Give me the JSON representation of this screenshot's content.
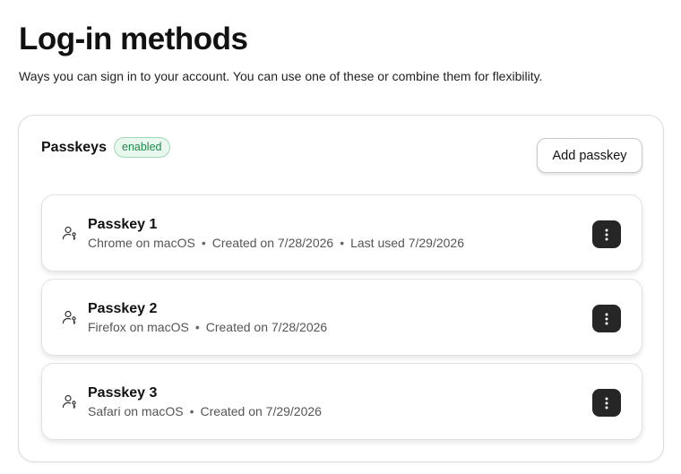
{
  "header": {
    "title": "Log-in methods",
    "subtitle": "Ways you can sign in to your account. You can use one of these or combine them for flexibility."
  },
  "passkeys_section": {
    "title": "Passkeys",
    "badge": "enabled",
    "add_button_label": "Add passkey",
    "separator": "•",
    "items": [
      {
        "name": "Passkey 1",
        "browser": "Chrome on macOS",
        "created": "Created on 7/28/2026",
        "last_used": "Last used 7/29/2026"
      },
      {
        "name": "Passkey 2",
        "browser": "Firefox on macOS",
        "created": "Created on 7/28/2026"
      },
      {
        "name": "Passkey 3",
        "browser": "Safari on macOS",
        "created": "Created on 7/29/2026"
      }
    ]
  },
  "icons": {
    "passkey": "user-key-icon",
    "more": "more-vertical-icon"
  },
  "colors": {
    "badge_bg": "#e9f8ee",
    "badge_text": "#1f8a4c",
    "badge_border": "#9fd9b4",
    "more_button_bg": "#262626"
  }
}
